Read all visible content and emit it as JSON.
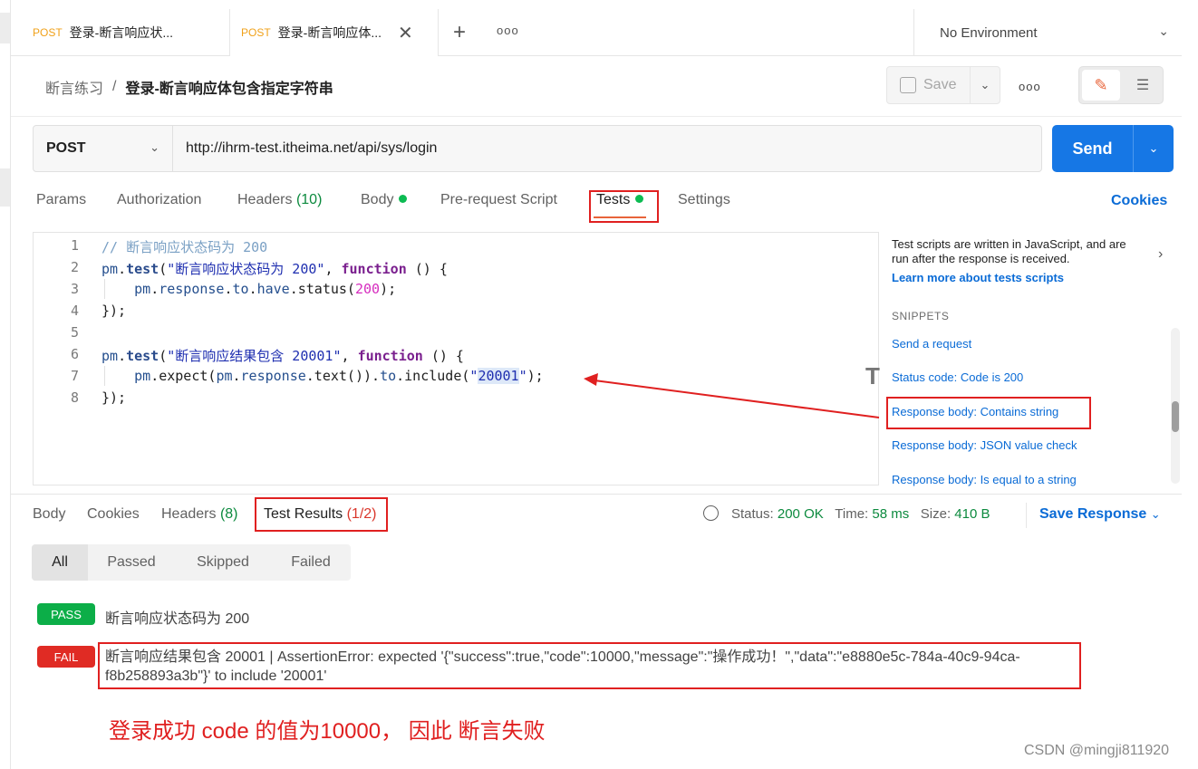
{
  "tabs": [
    {
      "method": "POST",
      "name": "登录-断言响应状..."
    },
    {
      "method": "POST",
      "name": "登录-断言响应体..."
    }
  ],
  "environment": "No Environment",
  "breadcrumb": {
    "collection": "断言练习",
    "separator": "/",
    "request": "登录-断言响应体包含指定字符串"
  },
  "toolbar": {
    "save_label": "Save"
  },
  "request": {
    "method": "POST",
    "url": "http://ihrm-test.itheima.net/api/sys/login",
    "send_label": "Send"
  },
  "request_tabs": {
    "params": "Params",
    "authorization": "Authorization",
    "headers": "Headers",
    "headers_count": "(10)",
    "body": "Body",
    "prerequest": "Pre-request Script",
    "tests": "Tests",
    "settings": "Settings",
    "cookies": "Cookies"
  },
  "editor": {
    "line_numbers": [
      "1",
      "2",
      "3",
      "4",
      "5",
      "6",
      "7",
      "8"
    ]
  },
  "side_panel": {
    "info": "Test scripts are written in JavaScript, and are run after the response is received.",
    "learn_more": "Learn more about tests scripts",
    "snippets_heading": "SNIPPETS",
    "snippets": [
      "Send a request",
      "Status code: Code is 200",
      "Response body: Contains string",
      "Response body: JSON value check",
      "Response body: Is equal to a string"
    ]
  },
  "response_tabs": {
    "body": "Body",
    "cookies": "Cookies",
    "headers": "Headers",
    "headers_count": "(8)",
    "test_results": "Test Results",
    "test_results_count": "(1/2)"
  },
  "response_meta": {
    "status_label": "Status:",
    "status_value": "200 OK",
    "time_label": "Time:",
    "time_value": "58 ms",
    "size_label": "Size:",
    "size_value": "410 B",
    "save_response": "Save Response"
  },
  "filters": [
    "All",
    "Passed",
    "Skipped",
    "Failed"
  ],
  "results": [
    {
      "status": "PASS",
      "text": "断言响应状态码为 200"
    },
    {
      "status": "FAIL",
      "text": "断言响应结果包含 20001 | AssertionError: expected '{\"success\":true,\"code\":10000,\"message\":\"操作成功！\",\"data\":\"e8880e5c-784a-40c9-94ca-f8b258893a3b\"}' to include '20001'"
    }
  ],
  "annotation": "登录成功 code 的值为10000，   因此 断言失败",
  "watermark": "CSDN @mingji811920",
  "colors": {
    "accent": "#1677e5",
    "pass": "#0cae48",
    "fail": "#e02b24",
    "annotation": "#e02020",
    "tab_underline": "#e8643a"
  }
}
